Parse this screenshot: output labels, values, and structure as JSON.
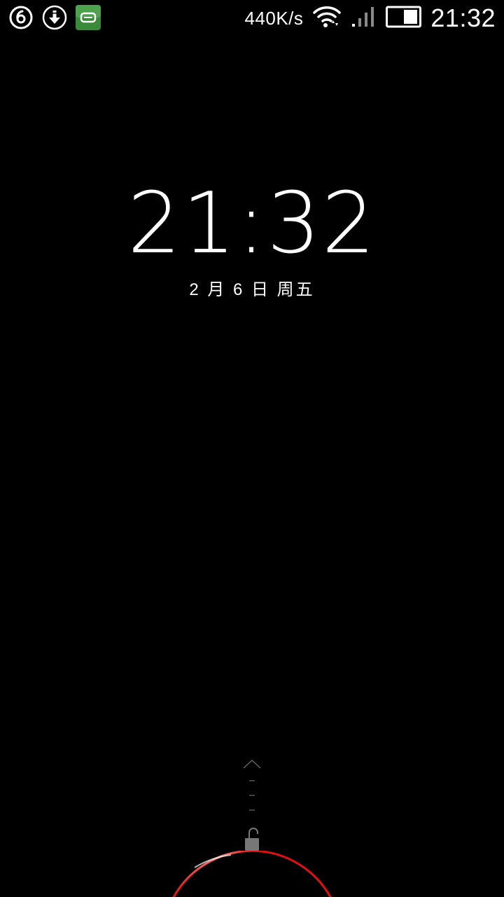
{
  "status_bar": {
    "net_speed": "440K/s",
    "time": "21:32",
    "icons": [
      "music-app-icon",
      "download-icon",
      "sms-app-icon",
      "wifi-icon",
      "signal-icon",
      "battery-icon"
    ]
  },
  "lockscreen": {
    "time": "21:32",
    "date": "2 月 6 日 周五",
    "icons": [
      "swipe-up-hint-icon",
      "unlock-icon"
    ]
  },
  "colors": {
    "background": "#000000",
    "text": "#ffffff",
    "app_green": "#3a8a3a",
    "ring_red": "#e01010",
    "hint_gray": "#666666"
  }
}
